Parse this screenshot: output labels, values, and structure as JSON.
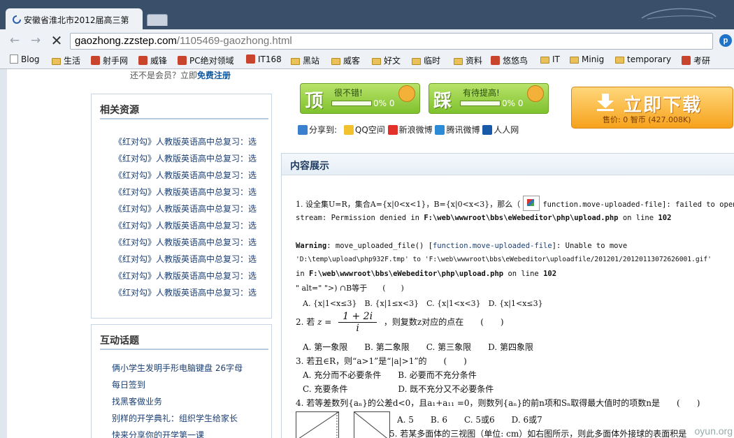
{
  "browser": {
    "tab_title": "安徽省淮北市2012届高三第",
    "url_host": "gaozhong.zzstep.com",
    "url_path": "/1105469-gaozhong.html",
    "ext_icon_label": "p",
    "bookmarks": [
      {
        "label": "Blog",
        "icon": "page-icon"
      },
      {
        "label": "生活",
        "icon": "folder-icon"
      },
      {
        "label": "射手网",
        "icon": "site-icon"
      },
      {
        "label": "威锋",
        "icon": "site-icon"
      },
      {
        "label": "PC绝对领域",
        "icon": "site-icon"
      },
      {
        "label": "IT168",
        "icon": "site-icon"
      },
      {
        "label": "黑站",
        "icon": "folder-icon"
      },
      {
        "label": "威客",
        "icon": "folder-icon"
      },
      {
        "label": "好文",
        "icon": "folder-icon"
      },
      {
        "label": "临时",
        "icon": "folder-icon"
      },
      {
        "label": "资料",
        "icon": "folder-icon"
      },
      {
        "label": "悠悠鸟",
        "icon": "site-icon"
      },
      {
        "label": "IT",
        "icon": "folder-icon"
      },
      {
        "label": "Minig",
        "icon": "folder-icon"
      },
      {
        "label": "temporary",
        "icon": "folder-icon"
      },
      {
        "label": "考研",
        "icon": "site-icon"
      }
    ]
  },
  "topnote": {
    "text": "还不是会员？立即",
    "register": "免费注册"
  },
  "sidebar": {
    "resources_title": "相关资源",
    "resources": [
      "《红对勾》人教版英语高中总复习：选",
      "《红对勾》人教版英语高中总复习：选",
      "《红对勾》人教版英语高中总复习：选",
      "《红对勾》人教版英语高中总复习：选",
      "《红对勾》人教版英语高中总复习：选",
      "《红对勾》人教版英语高中总复习：选",
      "《红对勾》人教版英语高中总复习：选",
      "《红对勾》人教版英语高中总复习：选",
      "《红对勾》人教版英语高中总复习：选",
      "《红对勾》人教版英语高中总复习：选"
    ],
    "topics_title": "互动话题",
    "topics": [
      "俩小学生发明手形电脑键盘 26字母",
      "每日签到",
      "找黑客做业务",
      "别样的开学典礼：组织学生给家长",
      "快来分享你的开学第一课"
    ]
  },
  "vote": {
    "up": {
      "big": "顶",
      "text": "很不错!",
      "pct": "0% 0"
    },
    "down": {
      "big": "踩",
      "text": "有待提高!",
      "pct": "0% 0"
    }
  },
  "download": {
    "label": "立即下载",
    "price": "售价: 0 智币 (427.008K)"
  },
  "share": {
    "label": "分享到:",
    "items": [
      "QQ空间",
      "新浪微博",
      "腾讯微博",
      "人人网"
    ]
  },
  "content": {
    "title": "内容展示",
    "q1a": "1. 设全集U=R，集合A={x|0<x<1}，B={x|0<x<3}，那么（",
    "q1b": "function.move-uploaded-file]: failed to open",
    "err1": "stream: Permission denied in",
    "path1": "F:\\web\\wwwroot\\bbs\\eWebeditor\\php\\upload.php",
    "online1": "on line",
    "line1": "102",
    "warn_label": "Warning",
    "warn_text": ": move_uploaded_file() [",
    "warn_link": "function.move-uploaded-file",
    "warn_text2": "]: Unable to move",
    "warn_paths": "'D:\\temp\\upload\\php932F.tmp' to 'F:\\web\\wwwroot\\bbs\\eWebeditor\\uploadfile/201201/20120113072626001.gif'",
    "in_label": "in",
    "path2": "F:\\web\\wwwroot\\bbs\\eWebeditor\\php\\upload.php",
    "online2": "on line",
    "line2": "102",
    "q1c": "\" alt=\" \">) ∩B等于　　(　　)",
    "q1opts": "A. {x|1<x≤3}　B. {x|1≤x<3}　C. {x|1<x<3}　D. {x|1<x≤3}",
    "q2a": "2. 若",
    "q2z": "z =",
    "q2num": "1 + 2i",
    "q2den": "i",
    "q2b": "，则复数z对应的点在　　(　　)",
    "q2opts": "A. 第一象限　　B. 第二象限　　C. 第三象限　　D. 第四象限",
    "q3": "3. 若丑∈R，则“a>1”是“|a|>1”的　　(　　)",
    "q3o1": "A. 充分而不必要条件　　B. 必要而不充分条件",
    "q3o2": "C. 充要条件　　　　　　D. 既不充分又不必要条件",
    "q4": "4. 若等差数列{aₙ}的公差d<0，且a₁+a₁₁ =0，则数列{aₙ}的前n项和Sₙ取得最大值时的项数n是　　(　　)",
    "q4opts": "A. 5　　B. 6　　C. 5或6　　D. 6或7",
    "q5": "5. 若某多面体的三视图（单位: cm）如右图所示，则此多面体外接球的表面积是"
  },
  "watermark": "oyun.org"
}
